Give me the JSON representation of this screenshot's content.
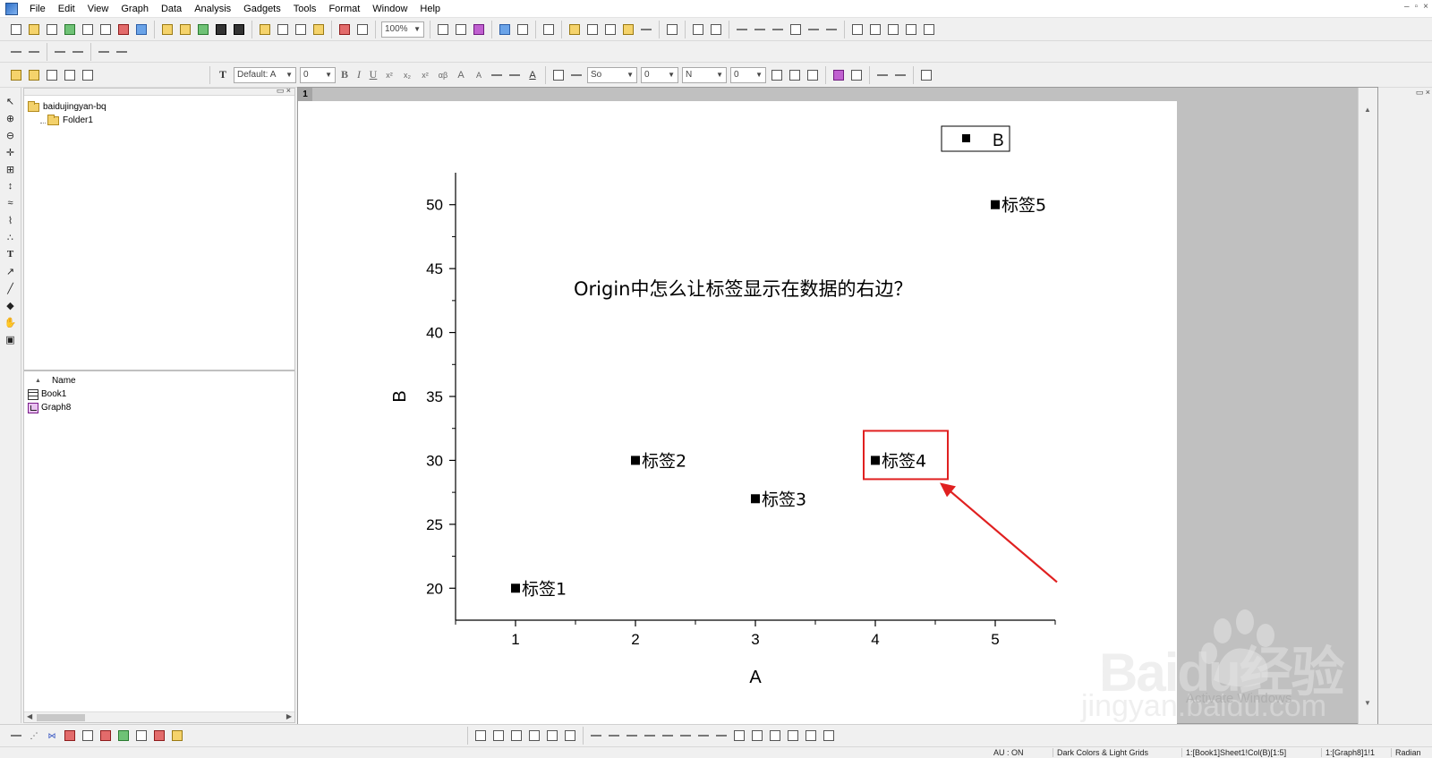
{
  "menu": {
    "items": [
      "File",
      "Edit",
      "View",
      "Graph",
      "Data",
      "Analysis",
      "Gadgets",
      "Tools",
      "Format",
      "Window",
      "Help"
    ]
  },
  "toolbar": {
    "zoom_value": "100%",
    "font_name": "Default: A",
    "font_size": "0",
    "line_style": "So",
    "line_width": "0",
    "fill_label": "N",
    "fill_value": "0",
    "bold": "B",
    "italic": "I",
    "underline": "U"
  },
  "explorer": {
    "root_folder": "baidujingyan-bq",
    "subfolder": "Folder1",
    "list_header": "Name",
    "files": [
      {
        "name": "Book1",
        "icon": "workbook-icon"
      },
      {
        "name": "Graph8",
        "icon": "graph-icon"
      }
    ]
  },
  "graph": {
    "page_number": "1",
    "title": "Origin中怎么让标签显示在数据的右边？",
    "accent_highlight": "#e02020",
    "arrow_color": "#e02020"
  },
  "chart_data": {
    "type": "scatter",
    "title": "",
    "xlabel": "A",
    "ylabel": "B",
    "xlim": [
      0.5,
      5.5
    ],
    "ylim": [
      17.5,
      52.5
    ],
    "x_ticks": [
      "1",
      "2",
      "3",
      "4",
      "5"
    ],
    "y_ticks": [
      "20",
      "25",
      "30",
      "35",
      "40",
      "45",
      "50"
    ],
    "legend": {
      "entries": [
        "B"
      ],
      "placement": "top-right"
    },
    "grid": false,
    "series": [
      {
        "name": "B",
        "x": [
          1,
          2,
          3,
          4,
          5
        ],
        "y": [
          20,
          30,
          27,
          30,
          50
        ],
        "labels": [
          "标签1",
          "标签2",
          "标签3",
          "标签4",
          "标签5"
        ],
        "marker": "square",
        "color": "#000000"
      }
    ],
    "highlighted_point_index": 3
  },
  "statusbar": {
    "au": "AU : ON",
    "theme": "Dark Colors & Light Grids",
    "selection": "1:[Book1]Sheet1!Col(B)[1:5]",
    "graph_ref": "1:[Graph8]1!1",
    "angle": "Radian"
  },
  "watermark": {
    "brand": "Baidu经验",
    "url": "jingyan.baidu.com",
    "activate": "Activate Windows"
  }
}
